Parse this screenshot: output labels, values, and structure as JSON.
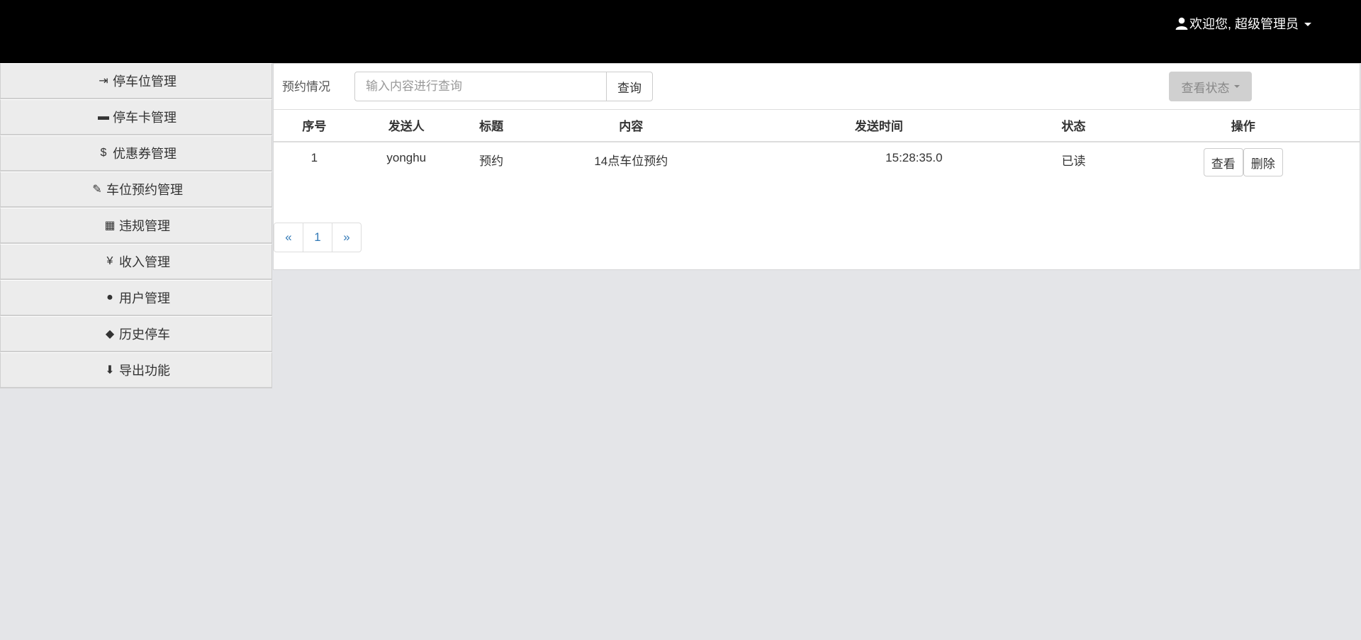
{
  "header": {
    "user_greeting": "欢迎您, 超级管理员",
    "user_icon": "user-icon"
  },
  "sidebar": {
    "items": [
      {
        "icon": "login-icon",
        "glyph": "⇥",
        "label": "停车位管理"
      },
      {
        "icon": "credit-card-icon",
        "glyph": "▬",
        "label": "停车卡管理"
      },
      {
        "icon": "dollar-icon",
        "glyph": "$",
        "label": "优惠券管理"
      },
      {
        "icon": "pushpin-icon",
        "glyph": "✎",
        "label": "车位预约管理"
      },
      {
        "icon": "grid-icon",
        "glyph": "▦",
        "label": "违规管理"
      },
      {
        "icon": "yen-icon",
        "glyph": "¥",
        "label": "收入管理"
      },
      {
        "icon": "user-icon",
        "glyph": "●",
        "label": "用户管理"
      },
      {
        "icon": "tags-icon",
        "glyph": "◆",
        "label": "历史停车"
      },
      {
        "icon": "download-circle-icon",
        "glyph": "⬇",
        "label": "导出功能"
      }
    ]
  },
  "main": {
    "title": "预约情况",
    "search": {
      "placeholder": "输入内容进行查询",
      "value": "",
      "button_label": "查询"
    },
    "status_dropdown_label": "查看状态",
    "table": {
      "columns": [
        "序号",
        "发送人",
        "标题",
        "内容",
        "发送时间",
        "状态",
        "操作"
      ],
      "rows": [
        {
          "index": "1",
          "sender": "yonghu",
          "title": "预约",
          "content": "14点车位预约",
          "send_time": "15:28:35.0",
          "status": "已读",
          "view_label": "查看",
          "delete_label": "删除"
        }
      ]
    },
    "pagination": {
      "prev": "«",
      "pages": [
        "1"
      ],
      "next": "»"
    }
  },
  "colors": {
    "topbar": "#000000",
    "background": "#e4e5e8",
    "link": "#337ab7"
  }
}
